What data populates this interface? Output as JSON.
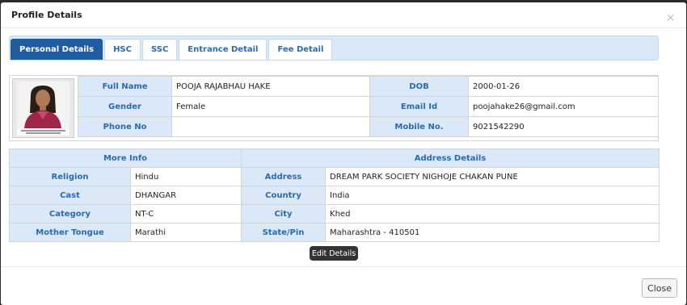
{
  "modal": {
    "title": "Profile Details",
    "close_glyph": "×"
  },
  "tabs": [
    {
      "label": "Personal Details",
      "active": true
    },
    {
      "label": "HSC",
      "active": false
    },
    {
      "label": "SSC",
      "active": false
    },
    {
      "label": "Entrance Detail",
      "active": false
    },
    {
      "label": "Fee Detail",
      "active": false
    }
  ],
  "personal": {
    "photo_icon": "student-photo",
    "full_name_label": "Full Name",
    "full_name": "POOJA RAJABHAU HAKE",
    "dob_label": "DOB",
    "dob": "2000-01-26",
    "gender_label": "Gender",
    "gender": "Female",
    "email_label": "Email Id",
    "email": "poojahake26@gmail.com",
    "phone_label": "Phone No",
    "phone": "",
    "mobile_label": "Mobile No.",
    "mobile": "9021542290"
  },
  "more_info": {
    "header": "More Info",
    "religion_label": "Religion",
    "religion": "Hindu",
    "cast_label": "Cast",
    "cast": "DHANGAR",
    "category_label": "Category",
    "category": "NT-C",
    "mother_tongue_label": "Mother Tongue",
    "mother_tongue": "Marathi"
  },
  "address": {
    "header": "Address Details",
    "address_label": "Address",
    "address": "DREAM PARK SOCIETY NIGHOJE CHAKAN PUNE",
    "country_label": "Country",
    "country": "India",
    "city_label": "City",
    "city": "Khed",
    "state_label": "State/Pin",
    "state": "Maharashtra - 410501"
  },
  "actions": {
    "edit_label": "Edit Details",
    "close_label": "Close"
  },
  "colors": {
    "accent": "#1f5da0",
    "label_bg": "#dbe8f8",
    "label_text": "#2a6bb0"
  }
}
